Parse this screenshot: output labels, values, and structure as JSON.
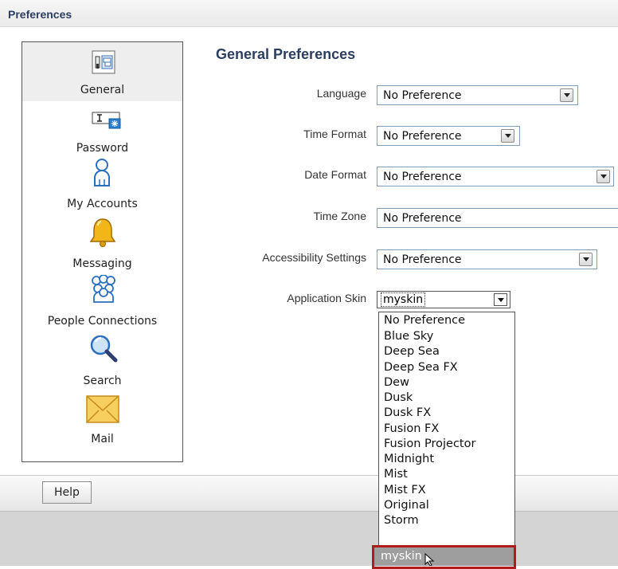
{
  "window": {
    "title": "Preferences"
  },
  "sidebar": {
    "items": [
      {
        "label": "General",
        "icon": "general-settings-icon",
        "selected": true
      },
      {
        "label": "Password",
        "icon": "password-icon"
      },
      {
        "label": "My Accounts",
        "icon": "user-icon"
      },
      {
        "label": "Messaging",
        "icon": "bell-icon"
      },
      {
        "label": "People Connections",
        "icon": "people-icon"
      },
      {
        "label": "Search",
        "icon": "magnifier-icon"
      },
      {
        "label": "Mail",
        "icon": "envelope-icon"
      }
    ]
  },
  "main": {
    "title": "General Preferences",
    "fields": [
      {
        "label": "Language",
        "value": "No Preference"
      },
      {
        "label": "Time Format",
        "value": "No Preference"
      },
      {
        "label": "Date Format",
        "value": "No Preference"
      },
      {
        "label": "Time Zone",
        "value": "No Preference"
      },
      {
        "label": "Accessibility Settings",
        "value": "No Preference"
      }
    ],
    "skin": {
      "label": "Application Skin",
      "value": "myskin",
      "options": [
        "No Preference",
        "Blue Sky",
        "Deep Sea",
        "Deep Sea FX",
        "Dew",
        "Dusk",
        "Dusk FX",
        "Fusion FX",
        "Fusion Projector",
        "Midnight",
        "Mist",
        "Mist FX",
        "Original",
        "Storm",
        "myskin"
      ],
      "highlighted": "myskin"
    }
  },
  "footer": {
    "help_label": "Help"
  },
  "colors": {
    "heading": "#2c3e5f",
    "highlight_border": "#b01c1c",
    "highlight_fill": "#9e9e9e"
  }
}
